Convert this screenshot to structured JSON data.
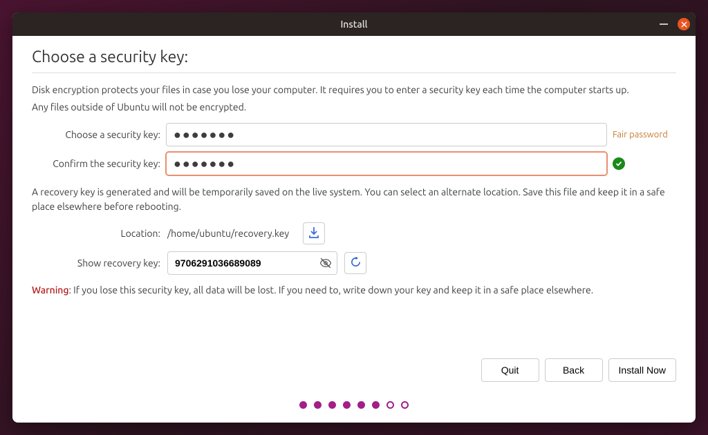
{
  "window": {
    "title": "Install"
  },
  "page": {
    "heading": "Choose a security key:",
    "desc1": "Disk encryption protects your files in case you lose your computer. It requires you to enter a security key each time the computer starts up.",
    "desc2": "Any files outside of Ubuntu will not be encrypted."
  },
  "fields": {
    "choose_label": "Choose a security key:",
    "choose_value": "●●●●●●●",
    "confirm_label": "Confirm the security key:",
    "confirm_value": "●●●●●●●",
    "strength_hint": "Fair password"
  },
  "recovery": {
    "note": "A recovery key is generated and will be temporarily saved on the live system. You can select an alternate location. Save this file and keep it in a safe place elsewhere before rebooting.",
    "location_label": "Location:",
    "location_path": "/home/ubuntu/recovery.key",
    "show_label": "Show recovery key:",
    "key_value": "9706291036689089"
  },
  "warning": {
    "word": "Warning",
    "text": ": If you lose this security key, all data will be lost. If you need to, write down your key and keep it in a safe place elsewhere."
  },
  "buttons": {
    "quit": "Quit",
    "back": "Back",
    "install": "Install Now"
  },
  "pager": {
    "total": 8,
    "filled": 6
  },
  "icons": {
    "save": "save-icon",
    "eye_off": "eye-off-icon",
    "refresh": "refresh-icon",
    "check": "check-icon",
    "close": "close-icon",
    "minimize": "minimize-icon"
  }
}
